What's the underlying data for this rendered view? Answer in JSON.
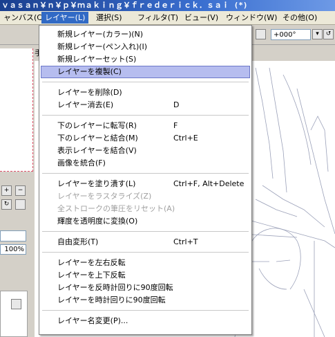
{
  "window": {
    "title": "ｖａｓａｎ￥ｎ￥ｐ￥ｍａｋｉｎｇ￥ｆｒｅｄｅｒｉｃｋ．ｓａｉ (*)"
  },
  "menubar": [
    {
      "label": "ャンバス(C)",
      "active": false
    },
    {
      "label": "レイヤー(L)",
      "active": true
    },
    {
      "label": "選択(S)",
      "active": false
    },
    {
      "label": "フィルタ(T)",
      "active": false
    },
    {
      "label": "ビュー(V)",
      "active": false
    },
    {
      "label": "ウィンドウ(W)",
      "active": false
    },
    {
      "label": "その他(O)",
      "active": false
    }
  ],
  "toolbar": {
    "angle_value": "+000°"
  },
  "left_panel": {
    "percent": "100%"
  },
  "canvas": {
    "tab_hint": "手"
  },
  "dropdown": {
    "items": [
      {
        "label": "新規レイヤー(カラー)(N)",
        "shortcut": "",
        "disabled": false,
        "selected": false
      },
      {
        "label": "新規レイヤー(ペン入れ)(I)",
        "shortcut": "",
        "disabled": false,
        "selected": false
      },
      {
        "label": "新規レイヤーセット(S)",
        "shortcut": "",
        "disabled": false,
        "selected": false
      },
      {
        "label": "レイヤーを複製(C)",
        "shortcut": "",
        "disabled": false,
        "selected": true
      },
      {
        "sep": true
      },
      {
        "label": "レイヤーを削除(D)",
        "shortcut": "",
        "disabled": false,
        "selected": false
      },
      {
        "label": "レイヤー消去(E)",
        "shortcut": "D",
        "disabled": false,
        "selected": false
      },
      {
        "sep": true
      },
      {
        "label": "下のレイヤーに転写(R)",
        "shortcut": "F",
        "disabled": false,
        "selected": false
      },
      {
        "label": "下のレイヤーと結合(M)",
        "shortcut": "Ctrl+E",
        "disabled": false,
        "selected": false
      },
      {
        "label": "表示レイヤーを結合(V)",
        "shortcut": "",
        "disabled": false,
        "selected": false
      },
      {
        "label": "画像を統合(F)",
        "shortcut": "",
        "disabled": false,
        "selected": false
      },
      {
        "sep": true
      },
      {
        "label": "レイヤーを塗り潰す(L)",
        "shortcut": "Ctrl+F, Alt+Delete",
        "disabled": false,
        "selected": false
      },
      {
        "label": "レイヤーをラスタライズ(Z)",
        "shortcut": "",
        "disabled": true,
        "selected": false
      },
      {
        "label": "全ストロークの筆圧をリセット(A)",
        "shortcut": "",
        "disabled": true,
        "selected": false
      },
      {
        "label": "輝度を透明度に変換(O)",
        "shortcut": "",
        "disabled": false,
        "selected": false
      },
      {
        "sep": true
      },
      {
        "label": "自由変形(T)",
        "shortcut": "Ctrl+T",
        "disabled": false,
        "selected": false
      },
      {
        "sep": true
      },
      {
        "label": "レイヤーを左右反転",
        "shortcut": "",
        "disabled": false,
        "selected": false
      },
      {
        "label": "レイヤーを上下反転",
        "shortcut": "",
        "disabled": false,
        "selected": false
      },
      {
        "label": "レイヤーを反時計回りに90度回転",
        "shortcut": "",
        "disabled": false,
        "selected": false
      },
      {
        "label": "レイヤーを時計回りに90度回転",
        "shortcut": "",
        "disabled": false,
        "selected": false
      },
      {
        "sep": true
      },
      {
        "label": "レイヤー名変更(P)...",
        "shortcut": "",
        "disabled": false,
        "selected": false
      }
    ]
  }
}
